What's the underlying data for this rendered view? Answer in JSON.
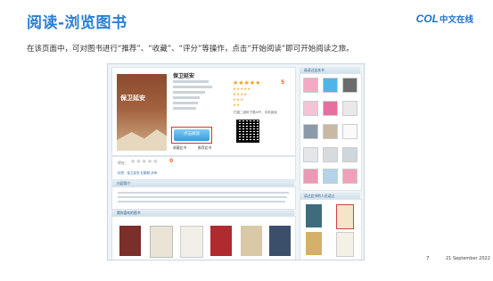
{
  "slide": {
    "title": "阅读-浏览图书",
    "description": "在该页面中，可对图书进行“推荐”、“收藏”、“评分”等操作，点击“开始阅读”即可开始阅读之旅。",
    "page_number": "7",
    "date": "21 September 2022",
    "brand_latin": "COL",
    "brand_cn": "中文在线"
  },
  "book": {
    "name": "保卫延安",
    "cover_title": "保卫延安",
    "rating": "5",
    "read_button": "点击阅读",
    "action_recommend": "收藏此书",
    "action_favorite": "推荐此书",
    "qr_caption": "扫描二维码下载APP，手机阅读"
  },
  "rating_row": {
    "label": "评分：",
    "score": "0",
    "tags": "标签：保卫延安 杜鹏程 战争"
  },
  "sections": {
    "intro": "内容简介",
    "recommend": "猜你喜欢的图书",
    "side_readers": "谁读过这本书",
    "side_books": "读过此书的人还读过"
  },
  "colors": {
    "accent": "#2a7fd4",
    "brand": "#1e73c8",
    "highlight_border": "#d9342b",
    "rating_orange": "#e6672a",
    "bottom_bar": "#1b4f8a"
  }
}
